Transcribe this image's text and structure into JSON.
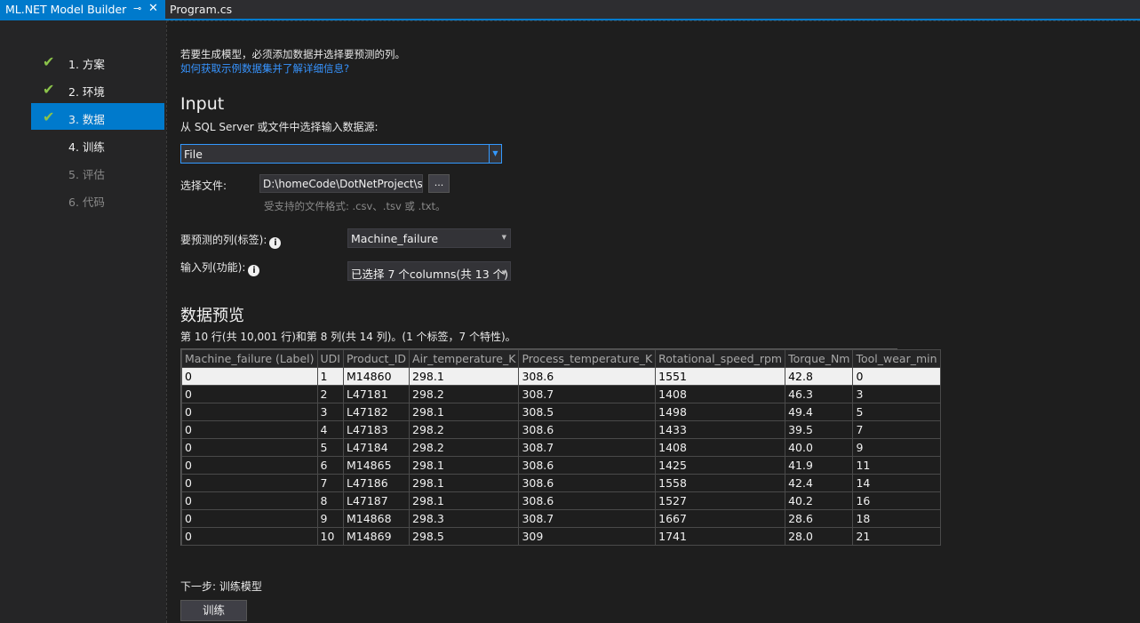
{
  "tabs": {
    "active_label": "ML.NET Model Builder",
    "pin_glyph": "⊸",
    "close_glyph": "✕",
    "inactive_label": "Program.cs"
  },
  "sidebar": {
    "items": [
      {
        "label": "1. 方案",
        "status": "done"
      },
      {
        "label": "2. 环境",
        "status": "done"
      },
      {
        "label": "3. 数据",
        "status": "active"
      },
      {
        "label": "4. 训练",
        "status": "pending"
      },
      {
        "label": "5. 评估",
        "status": "disabled"
      },
      {
        "label": "6. 代码",
        "status": "disabled"
      }
    ],
    "check_glyph": "✔"
  },
  "main": {
    "intro": "若要生成模型，必须添加数据并选择要预测的列。",
    "help_link": "如何获取示例数据集并了解详细信息?",
    "input_heading": "Input",
    "source_prompt": "从 SQL Server 或文件中选择输入数据源:",
    "source_value": "File",
    "file_label": "选择文件:",
    "file_path": "D:\\homeCode\\DotNetProject\\st",
    "browse_label": "...",
    "formats_hint": "受支持的文件格式: .csv、.tsv 或 .txt。",
    "label_column_label": "要预测的列(标签):",
    "label_column_value": "Machine_failure",
    "feature_columns_label": "输入列(功能):",
    "feature_columns_value": "已选择 7 个columns(共 13 个)",
    "preview_heading": "数据预览",
    "preview_summary": "第 10 行(共 10,001 行)和第 8 列(共 14 列)。(1 个标签，7 个特性)。",
    "next_step_label": "下一步: 训练模型",
    "train_button": "训练"
  },
  "table": {
    "headers": [
      "Machine_failure (Label)",
      "UDI",
      "Product_ID",
      "Air_temperature_K",
      "Process_temperature_K",
      "Rotational_speed_rpm",
      "Torque_Nm",
      "Tool_wear_min"
    ],
    "rows": [
      [
        "0",
        "1",
        "M14860",
        "298.1",
        "308.6",
        "1551",
        "42.8",
        "0"
      ],
      [
        "0",
        "2",
        "L47181",
        "298.2",
        "308.7",
        "1408",
        "46.3",
        "3"
      ],
      [
        "0",
        "3",
        "L47182",
        "298.1",
        "308.5",
        "1498",
        "49.4",
        "5"
      ],
      [
        "0",
        "4",
        "L47183",
        "298.2",
        "308.6",
        "1433",
        "39.5",
        "7"
      ],
      [
        "0",
        "5",
        "L47184",
        "298.2",
        "308.7",
        "1408",
        "40.0",
        "9"
      ],
      [
        "0",
        "6",
        "M14865",
        "298.1",
        "308.6",
        "1425",
        "41.9",
        "11"
      ],
      [
        "0",
        "7",
        "L47186",
        "298.1",
        "308.6",
        "1558",
        "42.4",
        "14"
      ],
      [
        "0",
        "8",
        "L47187",
        "298.1",
        "308.6",
        "1527",
        "40.2",
        "16"
      ],
      [
        "0",
        "9",
        "M14868",
        "298.3",
        "308.7",
        "1667",
        "28.6",
        "18"
      ],
      [
        "0",
        "10",
        "M14869",
        "298.5",
        "309",
        "1741",
        "28.0",
        "21"
      ]
    ],
    "selected_row": 0
  },
  "colors": {
    "accent": "#007acc",
    "link": "#3794ff",
    "check": "#8bc34a"
  }
}
